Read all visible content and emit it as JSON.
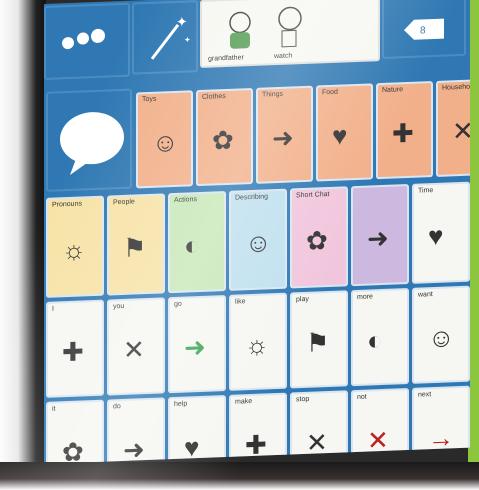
{
  "top_bar": {
    "sentence_words": [
      "grandfather",
      "watch"
    ],
    "back_tab_label": "8"
  },
  "rows": [
    {
      "cells": [
        {
          "label": "Toys",
          "color": "orange"
        },
        {
          "label": "Clothes",
          "color": "orange"
        },
        {
          "label": "Things",
          "color": "orange"
        },
        {
          "label": "Food",
          "color": "orange"
        },
        {
          "label": "Nature",
          "color": "orange"
        },
        {
          "label": "Household",
          "color": "orange"
        }
      ]
    },
    {
      "cells": [
        {
          "label": "Pronouns",
          "color": "yellow"
        },
        {
          "label": "People",
          "color": "yellow"
        },
        {
          "label": "Actions",
          "color": "green"
        },
        {
          "label": "Describing",
          "color": "blue"
        },
        {
          "label": "Short Chat",
          "color": "pink"
        },
        {
          "label": "",
          "color": "purple"
        },
        {
          "label": "Time",
          "color": "white"
        }
      ]
    },
    {
      "cells": [
        {
          "label": "I",
          "color": "white"
        },
        {
          "label": "you",
          "color": "white"
        },
        {
          "label": "go",
          "color": "white"
        },
        {
          "label": "like",
          "color": "white"
        },
        {
          "label": "play",
          "color": "white"
        },
        {
          "label": "more",
          "color": "white"
        },
        {
          "label": "want",
          "color": "white"
        }
      ]
    },
    {
      "cells": [
        {
          "label": "it",
          "color": "white"
        },
        {
          "label": "do",
          "color": "white"
        },
        {
          "label": "help",
          "color": "white"
        },
        {
          "label": "make",
          "color": "white"
        },
        {
          "label": "stop",
          "color": "white"
        },
        {
          "label": "not",
          "color": "white"
        },
        {
          "label": "next",
          "color": "white"
        }
      ]
    }
  ],
  "icons": {
    "home": "dots-icon",
    "clear": "magic-wand-icon",
    "speak": "speech-bubble-icon",
    "back": "backspace-icon"
  }
}
